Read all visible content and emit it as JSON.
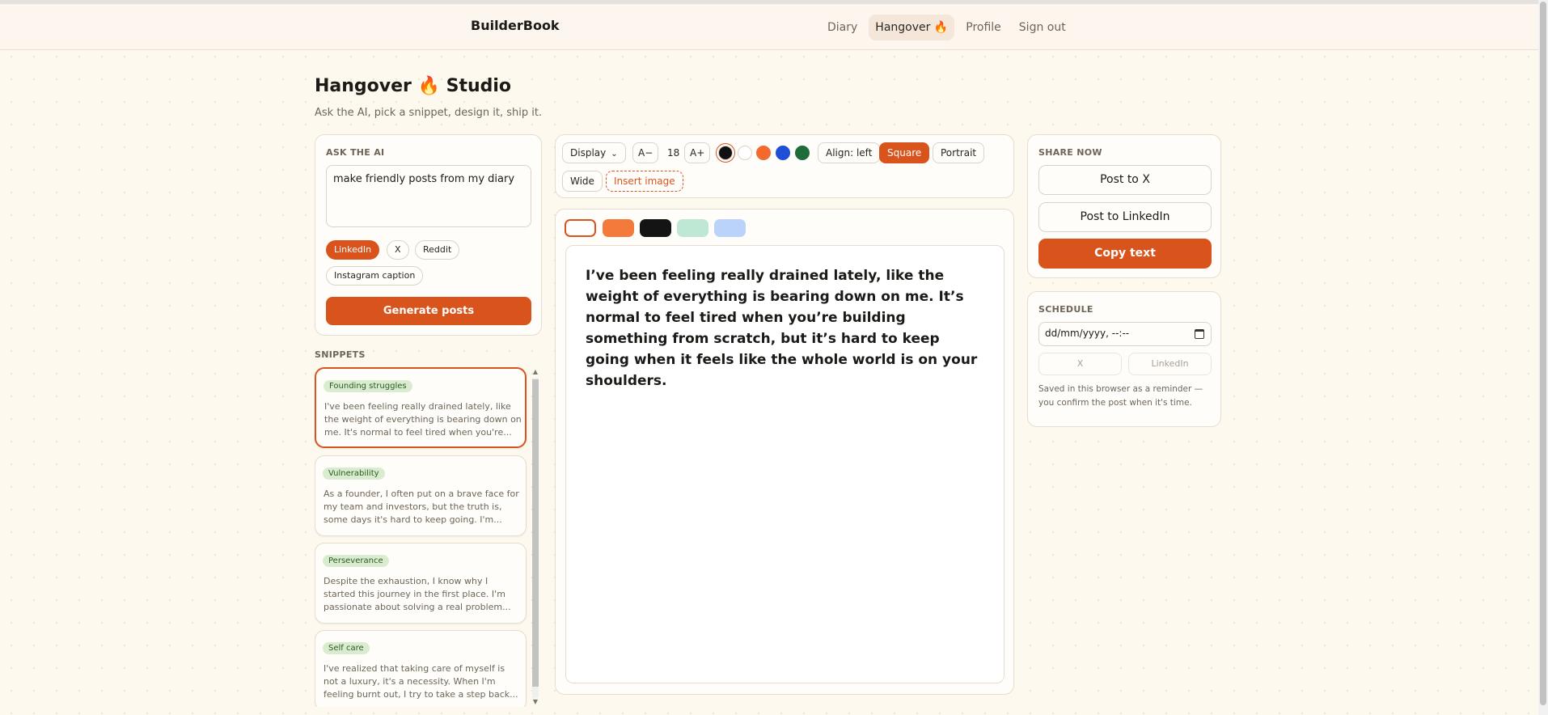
{
  "app": {
    "brand": "BuilderBook"
  },
  "nav": {
    "items": [
      {
        "label": "Diary",
        "active": false
      },
      {
        "label": "Hangover 🔥",
        "active": true
      },
      {
        "label": "Profile",
        "active": false
      },
      {
        "label": "Sign out",
        "active": false
      }
    ]
  },
  "page": {
    "title": "Hangover 🔥 Studio",
    "subtitle": "Ask the AI, pick a snippet, design it, ship it."
  },
  "ask": {
    "label": "ASK THE AI",
    "prompt_value": "make friendly posts from my diary",
    "platforms": [
      {
        "label": "LinkedIn",
        "active": true
      },
      {
        "label": "X",
        "active": false
      },
      {
        "label": "Reddit",
        "active": false
      },
      {
        "label": "Instagram caption",
        "active": false
      }
    ],
    "generate_label": "Generate posts"
  },
  "snippets": {
    "label": "SNIPPETS",
    "items": [
      {
        "tag": "Founding struggles",
        "text": "I've been feeling really drained lately, like the weight of everything is bearing down on me. It's normal to feel tired when you're...",
        "active": true
      },
      {
        "tag": "Vulnerability",
        "text": "As a founder, I often put on a brave face for my team and investors, but the truth is, some days it's hard to keep going. I'm...",
        "active": false
      },
      {
        "tag": "Perseverance",
        "text": "Despite the exhaustion, I know why I started this journey in the first place. I'm passionate about solving a real problem...",
        "active": false
      },
      {
        "tag": "Self care",
        "text": "I've realized that taking care of myself is not a luxury, it's a necessity. When I'm feeling burnt out, I try to take a step back...",
        "active": false
      }
    ]
  },
  "toolbar": {
    "font_select": "Display",
    "decrease_label": "A−",
    "font_size": "18",
    "increase_label": "A+",
    "text_colors": [
      "#111111",
      "#ffffff",
      "#f26a2e",
      "#1f4fd6",
      "#1f6b3a"
    ],
    "align_label": "Align: left",
    "formats": [
      {
        "label": "Square",
        "active": true
      },
      {
        "label": "Portrait",
        "active": false
      },
      {
        "label": "Wide",
        "active": false
      }
    ],
    "insert_image_label": "Insert image"
  },
  "canvas": {
    "backgrounds": [
      "#ffffff",
      "#f47a3c",
      "#141414",
      "#bfe8d4",
      "#b9d3fb"
    ],
    "post_text": "I’ve been feeling really drained lately, like the weight of everything is bearing down on me. It’s normal to feel tired when you’re building something from scratch, but it’s hard to keep going when it feels like the whole world is on your shoulders."
  },
  "share": {
    "label": "SHARE NOW",
    "post_x_label": "Post to X",
    "post_linkedin_label": "Post to LinkedIn",
    "copy_label": "Copy text"
  },
  "schedule": {
    "label": "SCHEDULE",
    "date_placeholder": "dd/mm/yyyy, --:--",
    "x_label": "X",
    "linkedin_label": "LinkedIn",
    "note": "Saved in this browser as a reminder — you confirm the post when it's time."
  },
  "colors": {
    "accent": "#d9541d",
    "tag_bg": "#d9ecd0",
    "page_bg": "#fdf9ef"
  }
}
